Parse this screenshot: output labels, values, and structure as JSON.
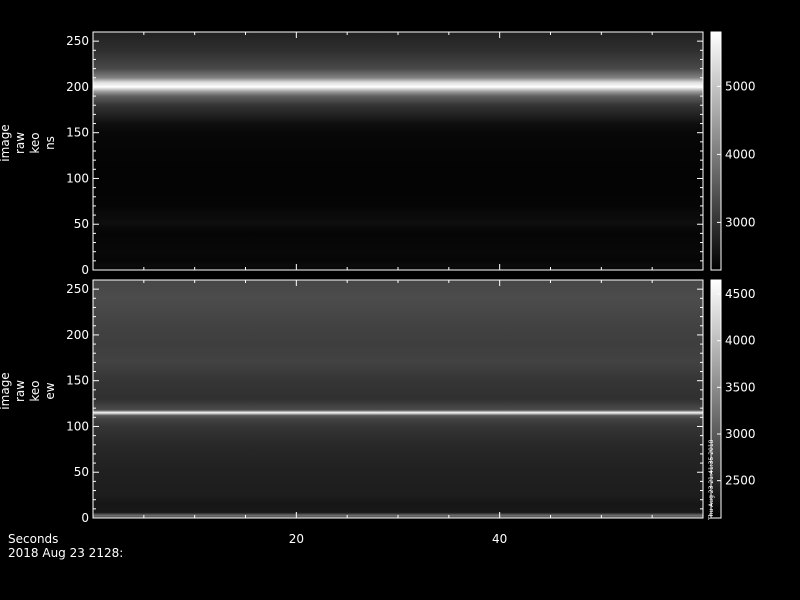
{
  "chart_data": [
    {
      "type": "heatmap",
      "title": "",
      "ylabel_lines": [
        "image",
        "raw",
        "keo",
        "ns"
      ],
      "ylim": [
        0,
        260
      ],
      "xlim": [
        0,
        60
      ],
      "yticks": [
        0,
        50,
        100,
        150,
        200,
        250
      ],
      "xticks": [
        20,
        40
      ],
      "colorbar": {
        "range": [
          2300,
          5800
        ],
        "ticks": [
          3000,
          4000,
          5000
        ]
      },
      "intensity_profile": [
        [
          0,
          2650
        ],
        [
          5,
          2800
        ],
        [
          10,
          2650
        ],
        [
          20,
          2700
        ],
        [
          30,
          2650
        ],
        [
          40,
          2600
        ],
        [
          45,
          2700
        ],
        [
          52,
          2900
        ],
        [
          56,
          2800
        ],
        [
          62,
          2750
        ],
        [
          70,
          2600
        ],
        [
          100,
          2550
        ],
        [
          130,
          2600
        ],
        [
          150,
          2700
        ],
        [
          160,
          2900
        ],
        [
          170,
          3300
        ],
        [
          180,
          3600
        ],
        [
          190,
          4200
        ],
        [
          195,
          4900
        ],
        [
          200,
          5800
        ],
        [
          205,
          5500
        ],
        [
          210,
          4600
        ],
        [
          220,
          3900
        ],
        [
          230,
          3700
        ],
        [
          240,
          3500
        ],
        [
          250,
          3400
        ],
        [
          258,
          3300
        ]
      ]
    },
    {
      "type": "heatmap",
      "title": "",
      "ylabel_lines": [
        "image",
        "raw",
        "keo",
        "ew"
      ],
      "ylim": [
        0,
        260
      ],
      "xlim": [
        0,
        60
      ],
      "yticks": [
        0,
        50,
        100,
        150,
        200,
        250
      ],
      "xticks": [
        20,
        40
      ],
      "colorbar": {
        "range": [
          2100,
          4650
        ],
        "ticks": [
          2500,
          3000,
          3500,
          4000,
          4500
        ]
      },
      "intensity_profile": [
        [
          0,
          3300
        ],
        [
          3,
          3600
        ],
        [
          6,
          2700
        ],
        [
          15,
          2650
        ],
        [
          25,
          2750
        ],
        [
          50,
          2800
        ],
        [
          80,
          2900
        ],
        [
          100,
          3050
        ],
        [
          108,
          3200
        ],
        [
          112,
          3400
        ],
        [
          115,
          4600
        ],
        [
          118,
          3300
        ],
        [
          130,
          3000
        ],
        [
          150,
          3050
        ],
        [
          170,
          3200
        ],
        [
          190,
          3150
        ],
        [
          210,
          3200
        ],
        [
          240,
          3300
        ],
        [
          258,
          3250
        ]
      ]
    }
  ],
  "footer": {
    "xlabel": "Seconds",
    "date_label": "2018 Aug 23 2128:",
    "timestamp": "Thu Aug 23 21:41:35 2018"
  }
}
